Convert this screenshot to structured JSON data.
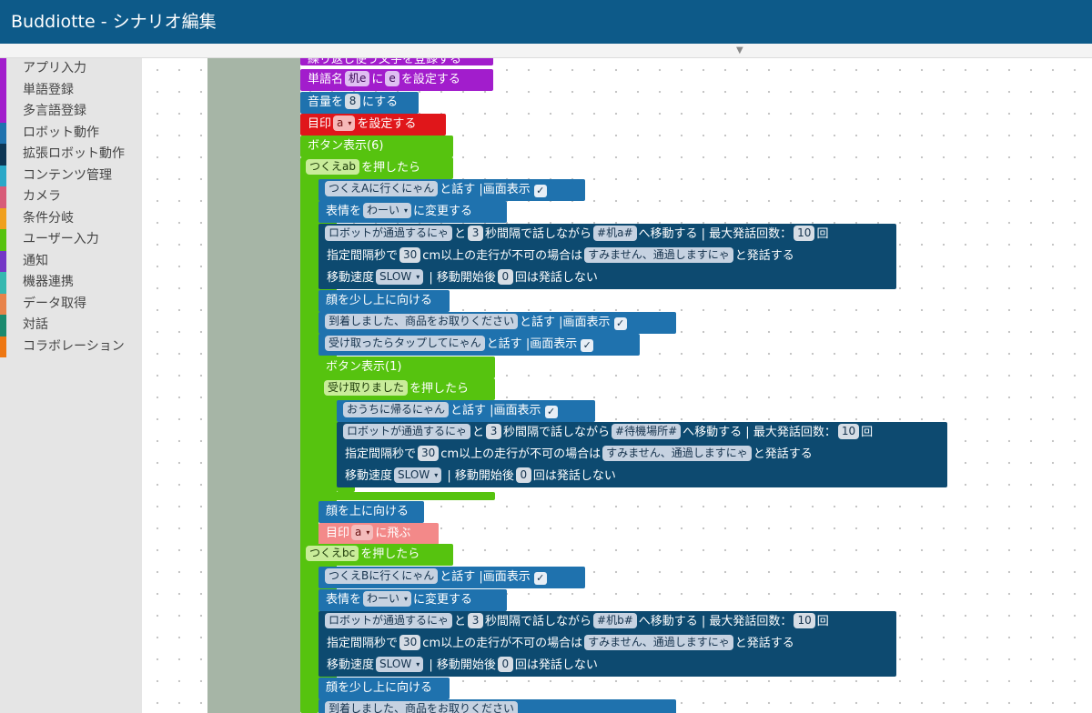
{
  "window": {
    "title": "Buddiotte - シナリオ編集"
  },
  "sidebar": {
    "categories": [
      {
        "label": "アプリ入力",
        "color": "#a21dcc"
      },
      {
        "label": "単語登録",
        "color": "#a21dcc"
      },
      {
        "label": "多言語登録",
        "color": "#a21dcc"
      },
      {
        "label": "ロボット動作",
        "color": "#1f72ae"
      },
      {
        "label": "拡張ロボット動作",
        "color": "#0d3654"
      },
      {
        "label": "コンテンツ管理",
        "color": "#2aa8c8"
      },
      {
        "label": "カメラ",
        "color": "#d85b78"
      },
      {
        "label": "条件分岐",
        "color": "#f0a01e"
      },
      {
        "label": "ユーザー入力",
        "color": "#56c30f"
      },
      {
        "label": "通知",
        "color": "#7437c6"
      },
      {
        "label": "機器連携",
        "color": "#36b8b0"
      },
      {
        "label": "データ取得",
        "color": "#e8834a"
      },
      {
        "label": "対話",
        "color": "#1b8a6e"
      },
      {
        "label": "コラボレーション",
        "color": "#ee7712"
      }
    ]
  },
  "blocks": {
    "b1": {
      "text": "繰り返し使う文字を登録する"
    },
    "b2": {
      "prefix": "単語名",
      "word": "机e",
      "mid": "に",
      "value": "e",
      "suffix": "を設定する"
    },
    "b3": {
      "prefix": "音量を",
      "value": "8",
      "suffix": "にする"
    },
    "b4": {
      "prefix": "目印",
      "value": "a",
      "suffix": "を設定する"
    },
    "b5": {
      "text": "ボタン表示(6)"
    },
    "b6": {
      "value": "つくえab",
      "suffix": "を押したら"
    },
    "b7": {
      "value": "つくえAに行くにゃん",
      "mid": "と話す",
      "suffix": "|画面表示",
      "check": "✓"
    },
    "b8": {
      "prefix": "表情を",
      "value": "わーい",
      "suffix": "に変更する"
    },
    "b9": {
      "msg": "ロボットが通過するにゃ",
      "and": "と",
      "interval": "3",
      "mid": "秒間隔で話しながら",
      "dest": "#机a#",
      "move": "へ移動する | 最大発話回数：",
      "max": "10",
      "times": "回",
      "l2pre": "指定間隔秒で",
      "dist": "30",
      "l2mid": "cm以上の走行が不可の場合は",
      "fail": "すみません、通過しますにゃ",
      "l2suf": "と発話する",
      "l3pre": "移動速度",
      "speed": "SLOW",
      "l3mid": "| 移動開始後",
      "after": "0",
      "l3suf": "回は発話しない"
    },
    "b10": {
      "text": "顔を少し上に向ける"
    },
    "b11": {
      "value": "到着しました、商品をお取りください",
      "mid": "と話す",
      "suffix": "|画面表示",
      "check": "✓"
    },
    "b12": {
      "value": "受け取ったらタップしてにゃん",
      "mid": "と話す",
      "suffix": "|画面表示",
      "check": "✓"
    },
    "b13": {
      "text": "ボタン表示(1)"
    },
    "b14": {
      "value": "受け取りました",
      "suffix": "を押したら"
    },
    "b15": {
      "value": "おうちに帰るにゃん",
      "mid": "と話す",
      "suffix": "|画面表示",
      "check": "✓"
    },
    "b16": {
      "msg": "ロボットが通過するにゃ",
      "and": "と",
      "interval": "3",
      "mid": "秒間隔で話しながら",
      "dest": "#待機場所#",
      "move": "へ移動する | 最大発話回数：",
      "max": "10",
      "times": "回",
      "l2pre": "指定間隔秒で",
      "dist": "30",
      "l2mid": "cm以上の走行が不可の場合は",
      "fail": "すみません、通過しますにゃ",
      "l2suf": "と発話する",
      "l3pre": "移動速度",
      "speed": "SLOW",
      "l3mid": "| 移動開始後",
      "after": "0",
      "l3suf": "回は発話しない"
    },
    "b17": {
      "text": "顔を上に向ける"
    },
    "b18": {
      "prefix": "目印",
      "value": "a",
      "suffix": "に飛ぶ"
    },
    "b19": {
      "value": "つくえbc",
      "suffix": "を押したら"
    },
    "b20": {
      "value": "つくえBに行くにゃん",
      "mid": "と話す",
      "suffix": "|画面表示",
      "check": "✓"
    },
    "b21": {
      "prefix": "表情を",
      "value": "わーい",
      "suffix": "に変更する"
    },
    "b22": {
      "msg": "ロボットが通過するにゃ",
      "and": "と",
      "interval": "3",
      "mid": "秒間隔で話しながら",
      "dest": "#机b#",
      "move": "へ移動する | 最大発話回数：",
      "max": "10",
      "times": "回",
      "l2pre": "指定間隔秒で",
      "dist": "30",
      "l2mid": "cm以上の走行が不可の場合は",
      "fail": "すみません、通過しますにゃ",
      "l2suf": "と発話する",
      "l3pre": "移動速度",
      "speed": "SLOW",
      "l3mid": "| 移動開始後",
      "after": "0",
      "l3suf": "回は発話しない"
    },
    "b23": {
      "text": "顔を少し上に向ける"
    },
    "b24": {
      "value": "到着しました、商品をお取りください"
    }
  },
  "icons": {
    "collapse_arrow": "▼",
    "dropdown_arrow": "▾"
  }
}
